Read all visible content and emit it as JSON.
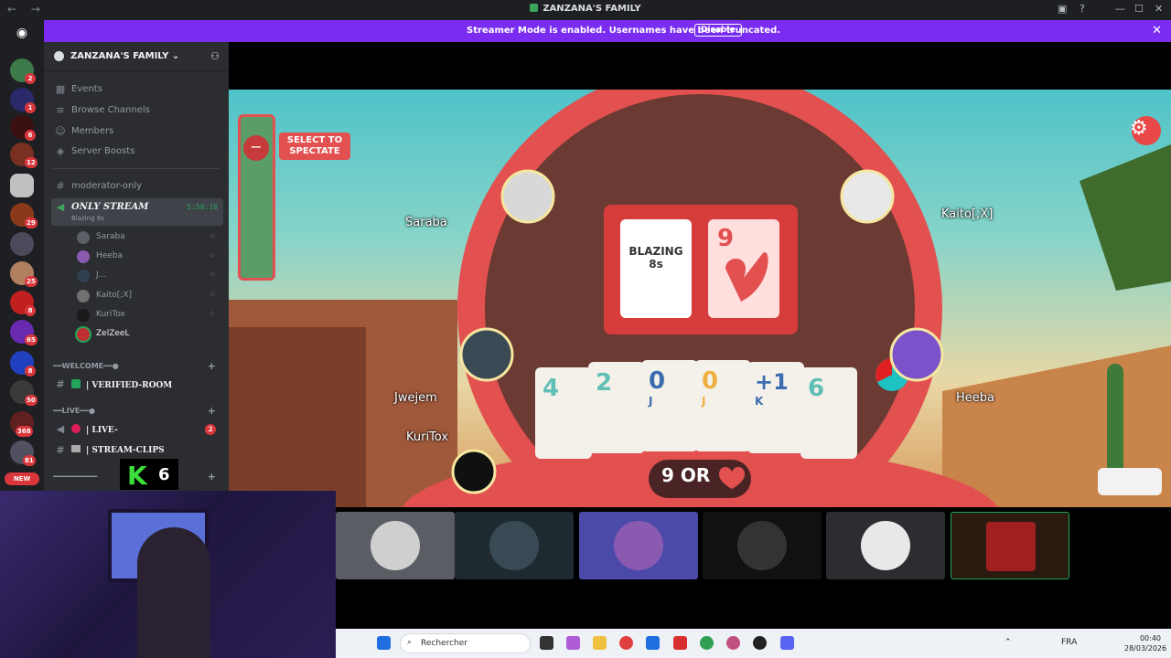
{
  "window": {
    "title": "ZANZANA'S FAMILY"
  },
  "banner": {
    "text": "Streamer Mode is enabled. Usernames have been truncated.",
    "disable_label": "Disable"
  },
  "rail_badges": [
    "2",
    "1",
    "6",
    "12",
    "29",
    "25",
    "8",
    "65",
    "8",
    "50",
    "368",
    "81"
  ],
  "rail_new": "NEW",
  "server": {
    "name": "ZANZANA'S FAMILY"
  },
  "top_items": [
    "Events",
    "Browse Channels",
    "Members",
    "Server Boosts"
  ],
  "channels": {
    "moderator": "moderator-only",
    "voice_name": "ONLY STREAM",
    "voice_timer": "5:58:10",
    "voice_activity": "Blazing 8s",
    "voice_users": [
      "Saraba",
      "Heeba",
      "J...",
      "Kaito[;X]",
      "KuriTox",
      "ZelZeeL"
    ],
    "cat_welcome": "━━WELCOME━━●",
    "verified_room": "| VERIFIED-ROOM",
    "cat_live": "━━LIVE━━●",
    "live": "| LIVE-",
    "live_badge": "2",
    "stream_clips": "| STREAM-CLIPS",
    "cat_more": "━━━━━━━━━━"
  },
  "overlay": {
    "k_number": "6"
  },
  "game": {
    "spectate": "SELECT TO SPECTATE",
    "card_logo": "BLAZING 8s",
    "top_card": "9",
    "players": [
      "Saraba",
      "Kaito[;X]",
      "Jwejem",
      "KuriTox",
      "Heeba"
    ],
    "hand": [
      "4",
      "2",
      "0",
      "0",
      "+1",
      "6"
    ],
    "hand_sub": [
      "",
      "",
      "J",
      "J",
      "K",
      ""
    ],
    "callout": "9 OR"
  },
  "taskbar": {
    "search": "Rechercher",
    "lang": "FRA",
    "time": "00:40",
    "date": "28/03/2026"
  },
  "colors": {
    "accent": "#7a2df0",
    "discord_bg": "#2b2d31",
    "table_red": "#e04848"
  }
}
